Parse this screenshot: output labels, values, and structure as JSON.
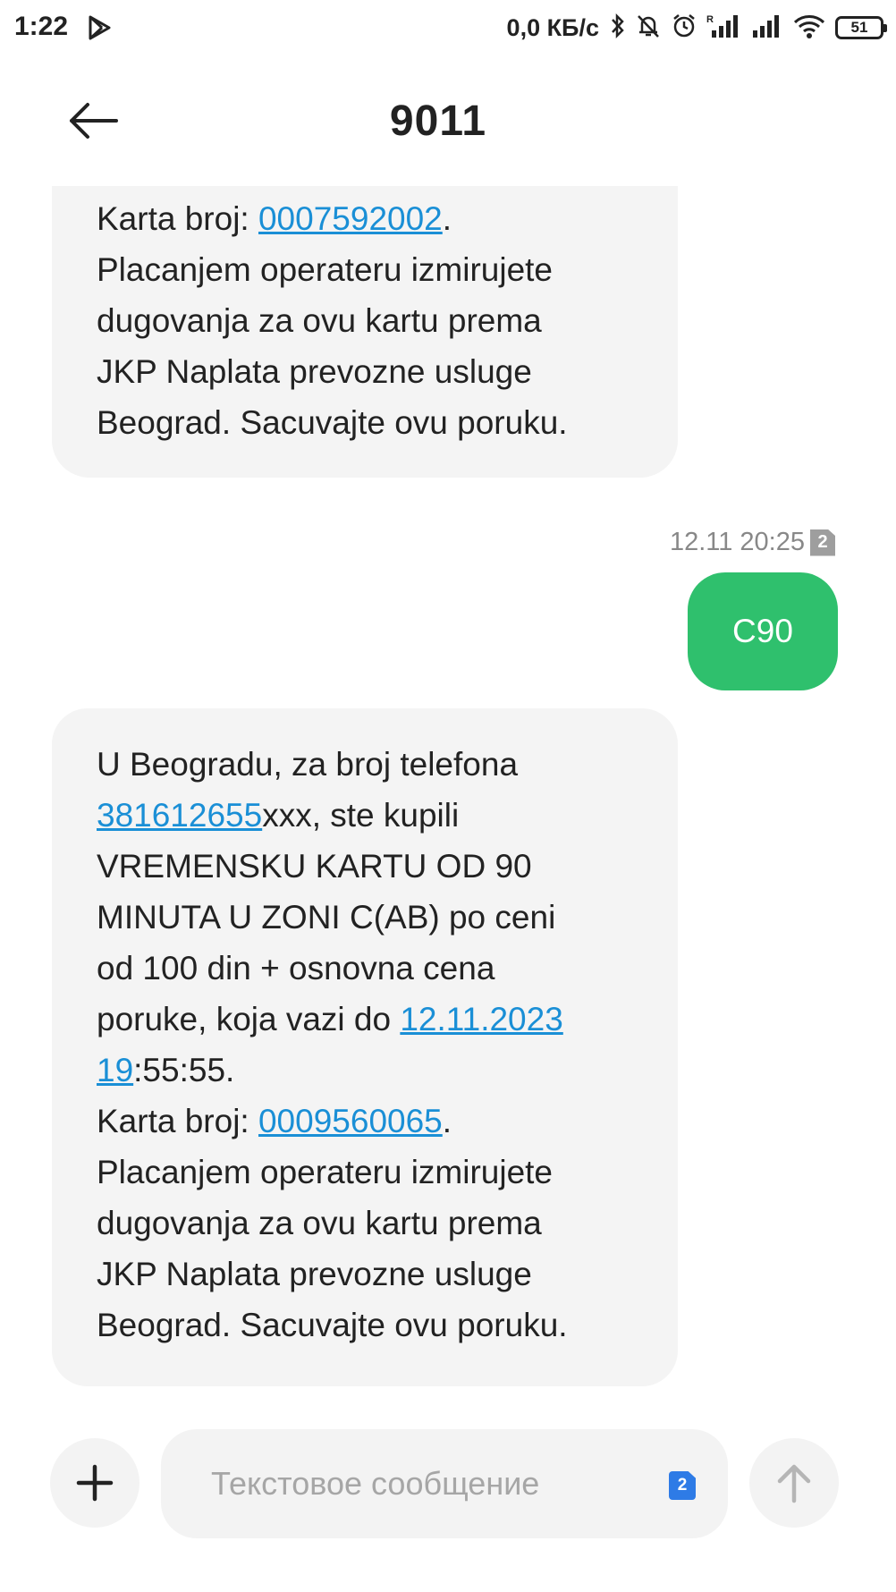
{
  "status_bar": {
    "time": "1:22",
    "speed": "0,0 КБ/с",
    "signal_label": "R",
    "battery": "51"
  },
  "header": {
    "title": "9011"
  },
  "messages": {
    "first": {
      "line1_prefix": "Karta broj: ",
      "card_number": "0007592002",
      "line1_suffix": ".",
      "body_lines": [
        "Placanjem operateru izmirujete",
        "dugovanja za ovu kartu prema",
        "JKP Naplata prevozne usluge",
        "Beograd. Sacuvajte ovu poruku."
      ]
    },
    "sent": {
      "meta": "12.11 20:25",
      "sim": "2",
      "text": "C90"
    },
    "second": {
      "line1": "U Beogradu, za broj telefona",
      "phone_link": "381612655",
      "phone_rest": "xxx, ste kupili",
      "line3": "VREMENSKU KARTU OD 90",
      "line4": "MINUTA U ZONI C(AB) po ceni",
      "line5": "od 100 din + osnovna cena",
      "line6_prefix": "poruke, koja vazi do ",
      "date_link_1": "12.11.2023",
      "date_link_2": "19",
      "time_rest": ":55:55.",
      "card_prefix": "Karta broj: ",
      "card_number": "0009560065",
      "card_suffix": ".",
      "body_lines": [
        "Placanjem operateru izmirujete",
        "dugovanja za ovu kartu prema",
        "JKP Naplata prevozne usluge",
        "Beograd. Sacuvajte ovu poruku."
      ]
    }
  },
  "compose": {
    "placeholder": "Текстовое сообщение",
    "sim": "2"
  },
  "colors": {
    "sent_bubble": "#2fc06d",
    "received_bubble": "#f4f4f4",
    "link": "#1a8fd6",
    "sim_badge": "#2e7be6"
  }
}
